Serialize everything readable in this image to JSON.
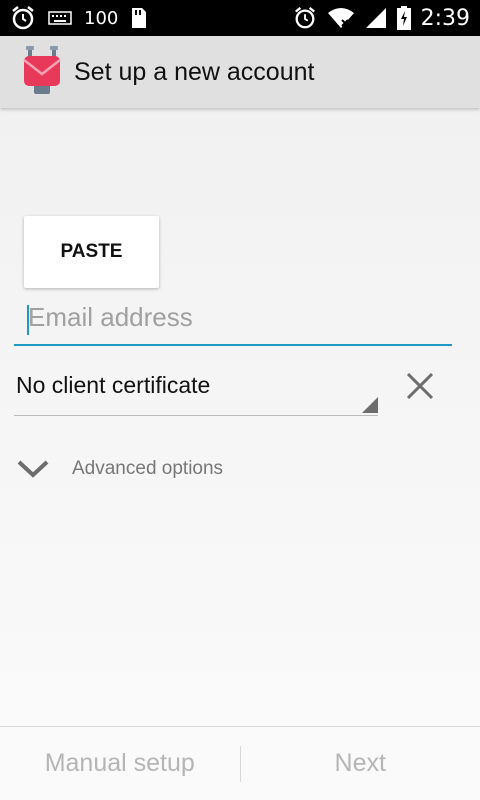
{
  "status_bar": {
    "battery_level": "100",
    "time": "2:39",
    "icons": [
      "alarm-icon",
      "keyboard-icon",
      "sd-card-icon",
      "alarm-icon",
      "wifi-icon",
      "signal-icon",
      "battery-charging-icon"
    ]
  },
  "action_bar": {
    "title": "Set up a new account",
    "logo_icon": "app-logo-icon"
  },
  "form": {
    "paste_label": "PASTE",
    "email_placeholder": "Email address",
    "email_value": "",
    "certificate_selected": "No client certificate",
    "advanced_options_label": "Advanced options"
  },
  "footer": {
    "manual_setup_label": "Manual setup",
    "next_label": "Next"
  },
  "colors": {
    "accent": "#1e98c4",
    "status_bar_bg": "#000000",
    "action_bar_bg": "#e0e0e0",
    "disabled_text": "#b5b5b5",
    "logo_red": "#e8395a"
  }
}
